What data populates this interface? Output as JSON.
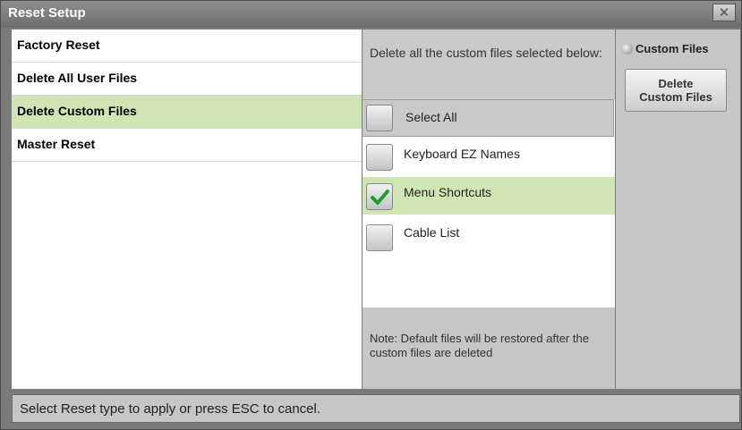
{
  "window": {
    "title": "Reset Setup",
    "close_glyph": "✕"
  },
  "left_menu": {
    "items": [
      {
        "label": "Factory Reset"
      },
      {
        "label": "Delete All User Files"
      },
      {
        "label": "Delete Custom Files",
        "selected": true
      },
      {
        "label": "Master Reset"
      }
    ]
  },
  "middle": {
    "instruction": "Delete all the custom files selected below:",
    "select_all_label": "Select All",
    "options": [
      {
        "label": "Keyboard EZ Names",
        "checked": false
      },
      {
        "label": "Menu Shortcuts",
        "checked": true
      },
      {
        "label": "Cable List",
        "checked": false
      }
    ],
    "note": "Note: Default files will be restored after the custom files are deleted"
  },
  "right": {
    "radio_label": "Custom Files",
    "delete_button_line1": "Delete",
    "delete_button_line2": "Custom Files"
  },
  "status_bar": {
    "text": "Select Reset type to apply or press ESC to cancel."
  },
  "colors": {
    "selected_row": "#cfe6b3",
    "check_green": "#1e9e2a"
  },
  "icons": {
    "close": "close-icon",
    "check": "checkmark-icon",
    "radio": "radio-icon"
  }
}
